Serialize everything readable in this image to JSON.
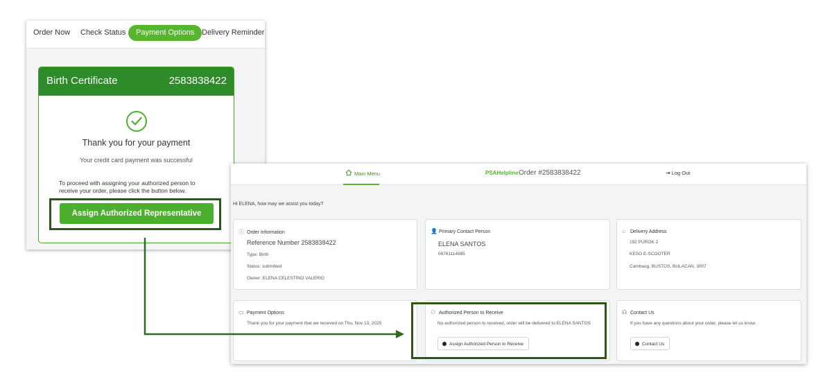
{
  "colors": {
    "brand_green": "#57b52d",
    "header_green": "#2e8b2a",
    "highlight_border": "#2a5718"
  },
  "left_screen": {
    "tabs": [
      {
        "label": "Order Now"
      },
      {
        "label": "Check Status"
      },
      {
        "label": "Payment Options",
        "active": true
      },
      {
        "label": "Delivery Reminders"
      }
    ],
    "certificate": {
      "title": "Birth Certificate",
      "number": "2583838422",
      "thanks": "Thank you for your payment",
      "cc_success": "Your credit card payment was successful",
      "proceed_text": "To proceed with assigning your authorized person to receive your order, please click the button below.",
      "assign_button": "Assign Authorized Representative"
    }
  },
  "right_screen": {
    "nav": {
      "main_menu": "Main Menu",
      "brand": "PSAHelpline",
      "order": "Order #2583838422",
      "logout": "Log Out"
    },
    "greeting": "Hi ELENA, how may we assist you today?",
    "order_info": {
      "title": "Order Information",
      "reference": "Reference Number 2583838422",
      "type": "Type: Birth",
      "status": "Status: submitted",
      "owner": "Owner: ELENA CELESTINO VALERIO"
    },
    "primary_contact": {
      "title": "Primary Contact Person",
      "name": "ELENA SANTOS",
      "phone": "09761114985"
    },
    "delivery_address": {
      "title": "Delivery Address",
      "line1": "192 PUROK 2",
      "line2": "KESO E-SCOOTER",
      "line3": "Cambaog, BUSTOS, BULACAN, 3007"
    },
    "payment_options": {
      "title": "Payment Options",
      "text": "Thank you for your payment that we received on Thu, Nov 13, 2025"
    },
    "authorized_person": {
      "title": "Authorized Person to Receive",
      "text": "No authorized person to received, order will be delivered to ELENA SANTOS",
      "button": "Assign Authorized Person to Receive"
    },
    "contact_us": {
      "title": "Contact Us",
      "text": "If you have any questions about your order, please let us know.",
      "button": "Contact Us"
    }
  }
}
